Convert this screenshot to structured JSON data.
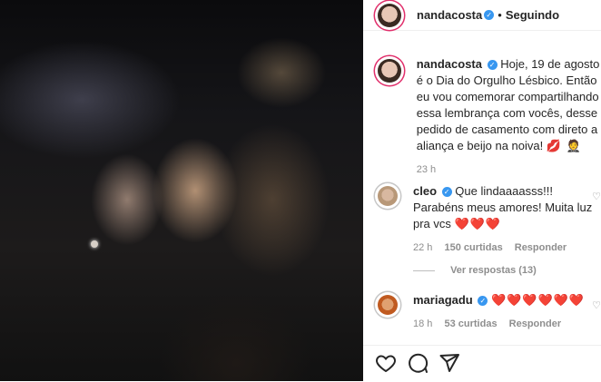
{
  "post": {
    "author": "nandacosta",
    "follow_status": "Seguindo",
    "caption": "Hoje, 19 de agosto é o Dia do Orgulho Lésbico. Então eu vou comemorar compartilhando essa lembrança com vocês, desse pedido de casamento com direto a aliança e beijo na noiva!",
    "caption_emoji": "💋 🤵",
    "caption_time": "23 h"
  },
  "comments": [
    {
      "user": "cleo",
      "text": "Que lindaaaasss!!! Parabéns meus amores! Muita luz pra vcs",
      "hearts": "❤️❤️❤️",
      "time": "22 h",
      "likes": "150 curtidas",
      "reply_label": "Responder",
      "view_replies": "Ver respostas (13)"
    },
    {
      "user": "mariagadu",
      "hearts": "❤️❤️❤️❤️❤️❤️",
      "time": "18 h",
      "likes": "53 curtidas",
      "reply_label": "Responder"
    }
  ],
  "colors": {
    "accent": "#3897f0",
    "heart": "#e41c3c",
    "muted": "#8e8e8e"
  },
  "icons": [
    "verified-icon",
    "heart-icon",
    "comment-icon",
    "share-icon",
    "like-comment-icon"
  ]
}
